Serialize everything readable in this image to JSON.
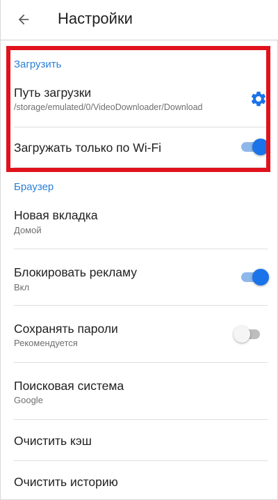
{
  "appbar": {
    "title": "Настройки",
    "back_icon": "arrow-left-icon"
  },
  "download_section": {
    "header": "Загрузить",
    "path": {
      "title": "Путь загрузки",
      "subtitle": "/storage/emulated/0/VideoDownloader/Download",
      "icon": "gear-icon"
    },
    "wifi_only": {
      "title": "Загружать только по Wi-Fi",
      "enabled": true
    }
  },
  "browser_section": {
    "header": "Браузер",
    "new_tab": {
      "title": "Новая вкладка",
      "subtitle": "Домой"
    },
    "block_ads": {
      "title": "Блокировать рекламу",
      "subtitle": "Вкл",
      "enabled": true
    },
    "save_passwords": {
      "title": "Сохранять пароли",
      "subtitle": "Рекомендуется",
      "enabled": false
    },
    "search_engine": {
      "title": "Поисковая система",
      "subtitle": "Google"
    },
    "clear_cache": {
      "title": "Очистить кэш"
    },
    "clear_history": {
      "title": "Очистить историю"
    }
  },
  "colors": {
    "accent": "#1a73e8",
    "section_header": "#2a7fd6",
    "highlight": "#e0121c"
  }
}
